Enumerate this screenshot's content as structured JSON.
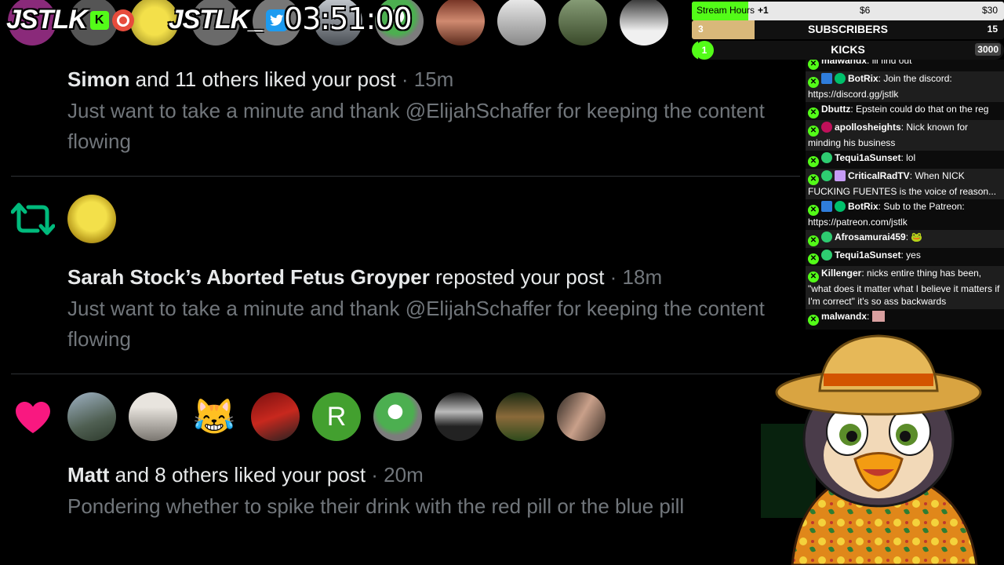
{
  "overlay": {
    "brand_left": "JSTLK",
    "brand_right": "JSTLK_",
    "kick_badge": "K",
    "stream_clock": "03:51:00"
  },
  "goals": {
    "stream_hours": {
      "label": "Stream Hours",
      "increment": "+1",
      "tier1": "$6",
      "tier2": "$30",
      "progress": 0.18
    },
    "subscribers": {
      "label": "SUBSCRIBERS",
      "current": "3",
      "goal": "15",
      "progress": 0.2
    },
    "kicks": {
      "label": "KICKS",
      "current": "1",
      "goal": "3000",
      "progress": 0.02
    }
  },
  "chat": {
    "messages": [
      {
        "user": "malwandx",
        "text": "ill find out",
        "color": "#fff"
      },
      {
        "user": "BotRix",
        "text": "Join the discord: https://discord.gg/jstlk",
        "color": "#fff"
      },
      {
        "user": "Dbuttz",
        "text": "Epstein could do that on the reg",
        "color": "#fff"
      },
      {
        "user": "apollosheights",
        "text": "Nick known for minding his business",
        "color": "#fff"
      },
      {
        "user": "Tequi1aSunset",
        "text": "lol",
        "color": "#fff"
      },
      {
        "user": "CriticalRadTV",
        "text": "When NICK FUCKING FUENTES is the voice of reason...",
        "color": "#fff"
      },
      {
        "user": "BotRix",
        "text": "Sub to the Patreon: https://patreon.com/jstlk",
        "color": "#fff"
      },
      {
        "user": "Afrosamurai459",
        "text": "",
        "color": "#fff"
      },
      {
        "user": "Tequi1aSunset",
        "text": "yes",
        "color": "#fff"
      },
      {
        "user": "Killenger",
        "text": "nicks entire thing has been, \"what does it matter what I believe it matters if I'm correct\" it's so ass backwards",
        "color": "#fff"
      },
      {
        "user": "malwandx",
        "text": "",
        "color": "#fff"
      }
    ]
  },
  "feed": {
    "items": [
      {
        "actor": "Simon",
        "action": " and 11 others liked your post",
        "time": " · 15m",
        "post": "Just want to take a minute and thank @ElijahSchaffer for keeping the content flowing"
      },
      {
        "actor": "Sarah Stock’s Aborted Fetus Groyper",
        "action": " reposted your post",
        "time": " · 18m",
        "post": "Just want to take a minute and thank @ElijahSchaffer for keeping the content flowing"
      },
      {
        "actor": "Matt",
        "action": " and 8 others liked your post",
        "time": " · 20m",
        "post": "Pondering whether to spike their drink with the red pill or the blue pill",
        "avatar_letter": "R"
      }
    ]
  },
  "colors": {
    "like": "#f91880",
    "repost": "#00ba7c",
    "kick_green": "#53fc18",
    "muted": "#71767b"
  }
}
